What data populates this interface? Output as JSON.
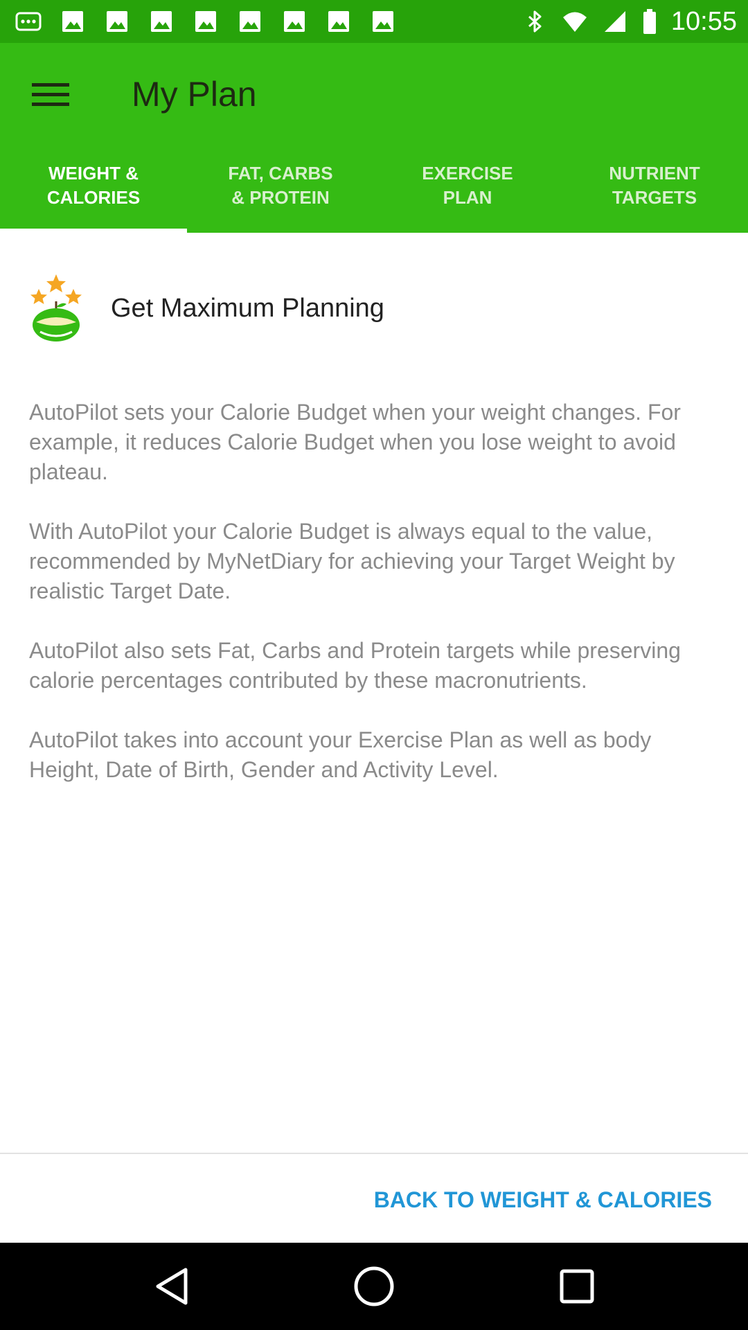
{
  "status_bar": {
    "time": "10:55",
    "left_icons": [
      "more-dots-icon",
      "picture-icon",
      "picture-icon",
      "picture-icon",
      "picture-icon",
      "picture-icon",
      "picture-icon",
      "picture-icon",
      "picture-icon"
    ],
    "right_icons": [
      "bluetooth-icon",
      "wifi-icon",
      "signal-icon",
      "battery-icon"
    ]
  },
  "app_bar": {
    "title": "My Plan",
    "menu_icon": "hamburger-menu-icon"
  },
  "tabs": [
    {
      "label": "WEIGHT &\nCALORIES",
      "active": true
    },
    {
      "label": "FAT, CARBS\n& PROTEIN",
      "active": false
    },
    {
      "label": "EXERCISE\nPLAN",
      "active": false
    },
    {
      "label": "NUTRIENT\nTARGETS",
      "active": false
    }
  ],
  "content": {
    "promo_icon": "stars-apple-icon",
    "promo_title": "Get Maximum Planning",
    "paragraphs": [
      "AutoPilot sets your Calorie Budget when your weight changes. For example, it reduces Calorie Budget when you lose weight to avoid plateau.",
      "With AutoPilot your Calorie Budget is always equal to the value, recommended by MyNetDiary for achieving your Target Weight by realistic Target Date.",
      "AutoPilot also sets Fat, Carbs and Protein targets while preserving calorie percentages contributed by these macronutrients.",
      "AutoPilot takes into account your Exercise Plan as well as body Height, Date of Birth, Gender and Activity Level."
    ]
  },
  "footer": {
    "back_label": "BACK TO WEIGHT & CALORIES"
  },
  "colors": {
    "status_bar": "#27a30a",
    "app_bar": "#35bb14",
    "link": "#2196d6",
    "body_text": "#8a8a8a"
  },
  "nav_bar": {
    "icons": [
      "back-triangle-icon",
      "home-circle-icon",
      "recents-square-icon"
    ]
  }
}
